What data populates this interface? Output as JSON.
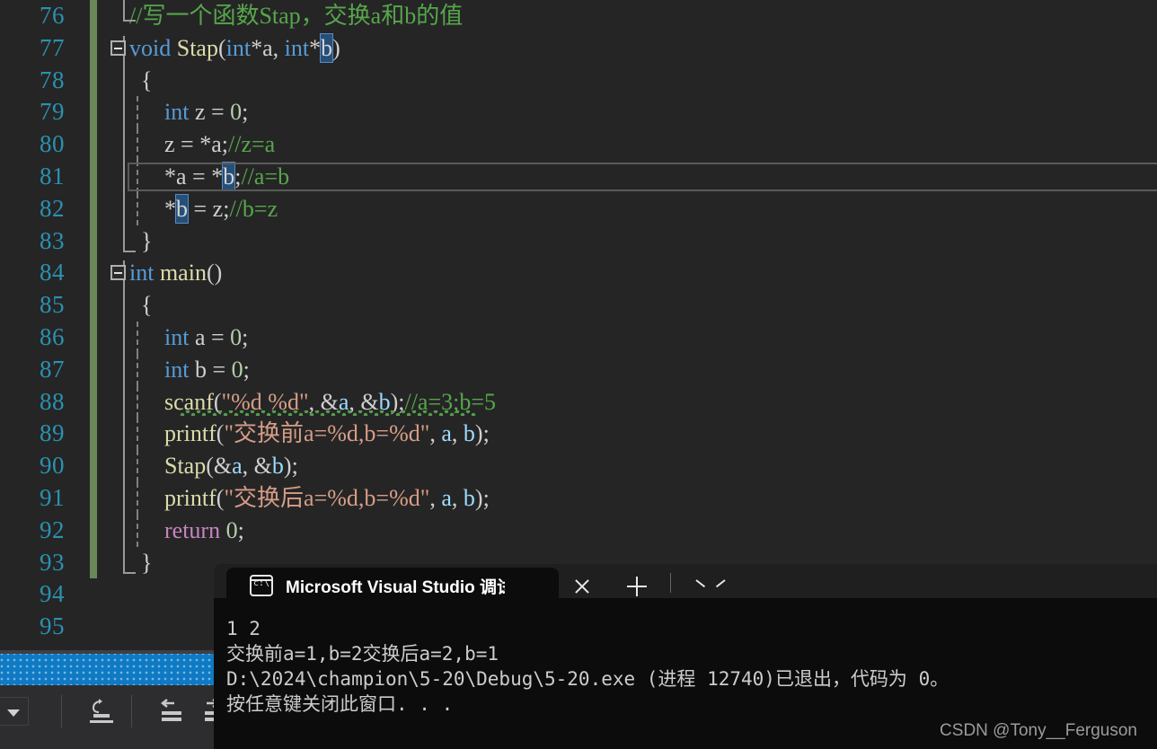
{
  "app": {
    "editor_theme": "dark",
    "background": "#252526",
    "line_number_color": "#2b91af",
    "change_bar_color": "#6a8759"
  },
  "editor": {
    "first_line": 76,
    "lines": [
      {
        "num": "76",
        "changed": true,
        "current": false,
        "tokens": [
          {
            "c": "t-com",
            "t": "//写一个函数Stap，交换a和b的值"
          }
        ],
        "indent": 0
      },
      {
        "num": "77",
        "changed": true,
        "current": false,
        "tokens": [
          {
            "c": "t-kw",
            "t": "void"
          },
          {
            "c": "t-plain",
            "t": " "
          },
          {
            "c": "t-fn",
            "t": "Stap"
          },
          {
            "c": "t-punc",
            "t": "("
          },
          {
            "c": "t-kw",
            "t": "int"
          },
          {
            "c": "t-punc",
            "t": "*"
          },
          {
            "c": "t-plain",
            "t": "a"
          },
          {
            "c": "t-punc",
            "t": ", "
          },
          {
            "c": "t-kw",
            "t": "int"
          },
          {
            "c": "t-punc",
            "t": "*"
          },
          {
            "c": "sel",
            "t": "b"
          },
          {
            "c": "t-punc",
            "t": ")"
          }
        ],
        "indent": 0
      },
      {
        "num": "78",
        "changed": true,
        "current": false,
        "tokens": [
          {
            "c": "t-punc",
            "t": "  {"
          }
        ],
        "indent": 0
      },
      {
        "num": "79",
        "changed": true,
        "current": false,
        "tokens": [
          {
            "c": "t-plain",
            "t": "      "
          },
          {
            "c": "t-kw",
            "t": "int"
          },
          {
            "c": "t-plain",
            "t": " z "
          },
          {
            "c": "t-punc",
            "t": "= "
          },
          {
            "c": "t-num",
            "t": "0"
          },
          {
            "c": "t-punc",
            "t": ";"
          }
        ],
        "indent": 1
      },
      {
        "num": "80",
        "changed": true,
        "current": false,
        "tokens": [
          {
            "c": "t-plain",
            "t": "      z "
          },
          {
            "c": "t-punc",
            "t": "= *"
          },
          {
            "c": "t-plain",
            "t": "a"
          },
          {
            "c": "t-punc",
            "t": ";"
          },
          {
            "c": "t-com",
            "t": "//z=a"
          }
        ],
        "indent": 1
      },
      {
        "num": "81",
        "changed": true,
        "current": true,
        "tokens": [
          {
            "c": "t-punc",
            "t": "      *"
          },
          {
            "c": "t-plain",
            "t": "a "
          },
          {
            "c": "t-punc",
            "t": "= *"
          },
          {
            "c": "sel",
            "t": "b"
          },
          {
            "c": "t-punc",
            "t": ";"
          },
          {
            "c": "t-com",
            "t": "//a=b"
          }
        ],
        "indent": 1
      },
      {
        "num": "82",
        "changed": true,
        "current": false,
        "tokens": [
          {
            "c": "t-punc",
            "t": "      *"
          },
          {
            "c": "sel",
            "t": "b"
          },
          {
            "c": "t-plain",
            "t": " "
          },
          {
            "c": "t-punc",
            "t": "= "
          },
          {
            "c": "t-plain",
            "t": "z"
          },
          {
            "c": "t-punc",
            "t": ";"
          },
          {
            "c": "t-com",
            "t": "//b=z"
          }
        ],
        "indent": 1
      },
      {
        "num": "83",
        "changed": true,
        "current": false,
        "tokens": [
          {
            "c": "t-punc",
            "t": "  }"
          }
        ],
        "indent": 0
      },
      {
        "num": "84",
        "changed": true,
        "current": false,
        "tokens": [
          {
            "c": "t-kw",
            "t": "int"
          },
          {
            "c": "t-plain",
            "t": " "
          },
          {
            "c": "t-fn",
            "t": "main"
          },
          {
            "c": "t-punc",
            "t": "()"
          }
        ],
        "indent": 0
      },
      {
        "num": "85",
        "changed": true,
        "current": false,
        "tokens": [
          {
            "c": "t-punc",
            "t": "  {"
          }
        ],
        "indent": 0
      },
      {
        "num": "86",
        "changed": true,
        "current": false,
        "tokens": [
          {
            "c": "t-plain",
            "t": "      "
          },
          {
            "c": "t-kw",
            "t": "int"
          },
          {
            "c": "t-plain",
            "t": " a "
          },
          {
            "c": "t-punc",
            "t": "= "
          },
          {
            "c": "t-num",
            "t": "0"
          },
          {
            "c": "t-punc",
            "t": ";"
          }
        ],
        "indent": 1
      },
      {
        "num": "87",
        "changed": true,
        "current": false,
        "tokens": [
          {
            "c": "t-plain",
            "t": "      "
          },
          {
            "c": "t-kw",
            "t": "int"
          },
          {
            "c": "t-plain",
            "t": " b "
          },
          {
            "c": "t-punc",
            "t": "= "
          },
          {
            "c": "t-num",
            "t": "0"
          },
          {
            "c": "t-punc",
            "t": ";"
          }
        ],
        "indent": 1
      },
      {
        "num": "88",
        "changed": true,
        "current": false,
        "squiggle": true,
        "tokens": [
          {
            "c": "t-plain",
            "t": "      "
          },
          {
            "c": "t-fn",
            "t": "scanf"
          },
          {
            "c": "t-punc",
            "t": "("
          },
          {
            "c": "t-str",
            "t": "\"%d %d\""
          },
          {
            "c": "t-punc",
            "t": ", &"
          },
          {
            "c": "t-var",
            "t": "a"
          },
          {
            "c": "t-punc",
            "t": ", &"
          },
          {
            "c": "t-var",
            "t": "b"
          },
          {
            "c": "t-punc",
            "t": ");"
          },
          {
            "c": "t-com",
            "t": "//a=3;b=5"
          }
        ],
        "indent": 1
      },
      {
        "num": "89",
        "changed": true,
        "current": false,
        "tokens": [
          {
            "c": "t-plain",
            "t": "      "
          },
          {
            "c": "t-fn",
            "t": "printf"
          },
          {
            "c": "t-punc",
            "t": "("
          },
          {
            "c": "t-str",
            "t": "\"交换前a=%d,b=%d\""
          },
          {
            "c": "t-punc",
            "t": ", "
          },
          {
            "c": "t-var",
            "t": "a"
          },
          {
            "c": "t-punc",
            "t": ", "
          },
          {
            "c": "t-var",
            "t": "b"
          },
          {
            "c": "t-punc",
            "t": ");"
          }
        ],
        "indent": 1
      },
      {
        "num": "90",
        "changed": true,
        "current": false,
        "tokens": [
          {
            "c": "t-plain",
            "t": "      "
          },
          {
            "c": "t-fn",
            "t": "Stap"
          },
          {
            "c": "t-punc",
            "t": "(&"
          },
          {
            "c": "t-var",
            "t": "a"
          },
          {
            "c": "t-punc",
            "t": ", &"
          },
          {
            "c": "t-var",
            "t": "b"
          },
          {
            "c": "t-punc",
            "t": ");"
          }
        ],
        "indent": 1
      },
      {
        "num": "91",
        "changed": true,
        "current": false,
        "tokens": [
          {
            "c": "t-plain",
            "t": "      "
          },
          {
            "c": "t-fn",
            "t": "printf"
          },
          {
            "c": "t-punc",
            "t": "("
          },
          {
            "c": "t-str",
            "t": "\"交换后a=%d,b=%d\""
          },
          {
            "c": "t-punc",
            "t": ", "
          },
          {
            "c": "t-var",
            "t": "a"
          },
          {
            "c": "t-punc",
            "t": ", "
          },
          {
            "c": "t-var",
            "t": "b"
          },
          {
            "c": "t-punc",
            "t": ");"
          }
        ],
        "indent": 1
      },
      {
        "num": "92",
        "changed": true,
        "current": false,
        "tokens": [
          {
            "c": "t-plain",
            "t": "      "
          },
          {
            "c": "t-ctrl",
            "t": "return"
          },
          {
            "c": "t-plain",
            "t": " "
          },
          {
            "c": "t-num",
            "t": "0"
          },
          {
            "c": "t-punc",
            "t": ";"
          }
        ],
        "indent": 1
      },
      {
        "num": "93",
        "changed": true,
        "current": false,
        "tokens": [
          {
            "c": "t-punc",
            "t": "  }"
          }
        ],
        "indent": 0
      },
      {
        "num": "94",
        "changed": false,
        "current": false,
        "tokens": [],
        "indent": -1
      },
      {
        "num": "95",
        "changed": false,
        "current": false,
        "tokens": [],
        "indent": -1
      }
    ]
  },
  "console": {
    "tab_title": "Microsoft Visual Studio 调试控",
    "tab_icon": "cmd-icon",
    "close_label": "close-icon",
    "new_tab_label": "new-tab-icon",
    "dropdown_label": "chevron-down-icon",
    "output_lines": [
      "1 2",
      "交换前a=1,b=2交换后a=2,b=1",
      "D:\\2024\\champion\\5-20\\Debug\\5-20.exe (进程 12740)已退出，代码为 0。",
      "按任意键关闭此窗口. . ."
    ]
  },
  "watermark": {
    "text": "CSDN @Tony__Ferguson"
  },
  "bottom_toolbar": {
    "progress_color": "#0e7ac4",
    "buttons": [
      {
        "name": "filter-dropdown",
        "label": ""
      },
      {
        "name": "undo-indent-button",
        "label": ""
      },
      {
        "name": "outdent-button",
        "label": ""
      },
      {
        "name": "indent-button",
        "label": ""
      },
      {
        "name": "clear-list-button",
        "label": ""
      },
      {
        "name": "sort-button",
        "label": ""
      }
    ]
  }
}
